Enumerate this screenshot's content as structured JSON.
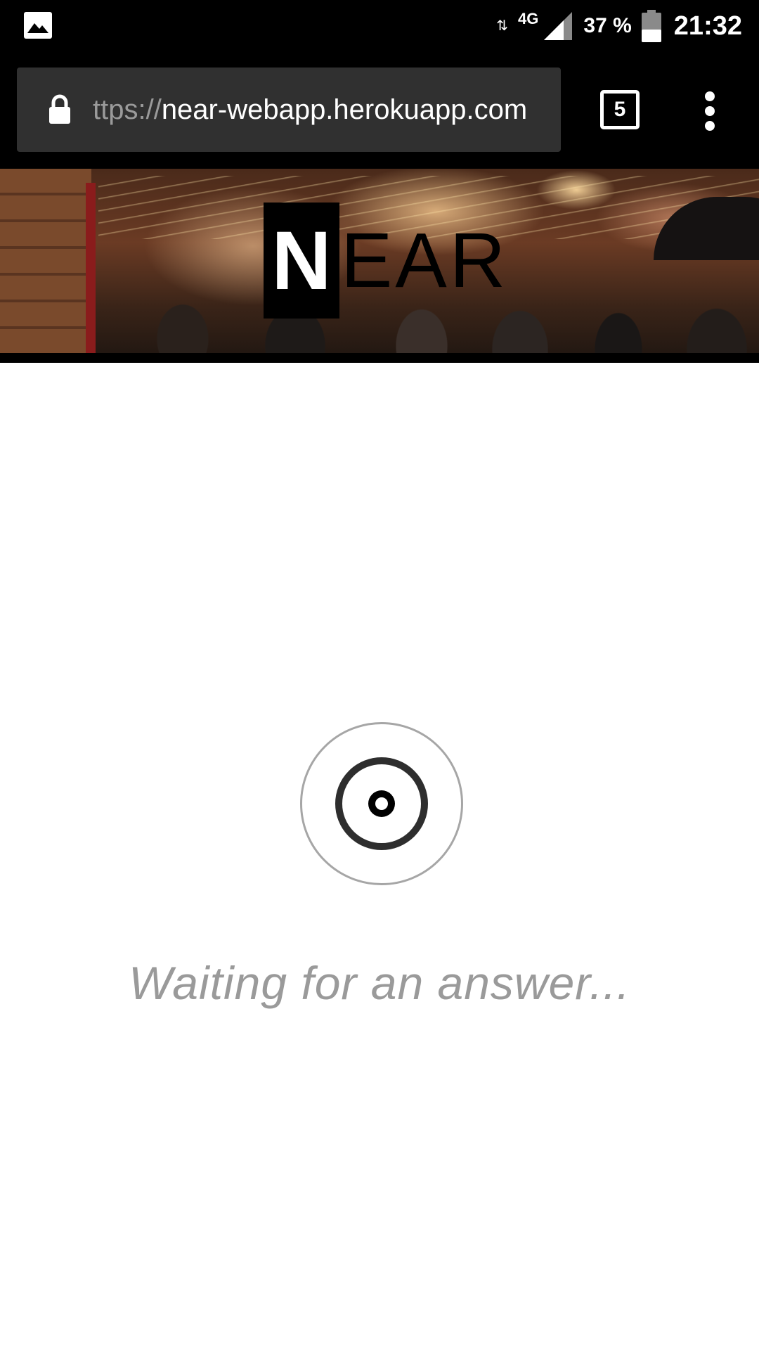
{
  "status_bar": {
    "left_icon": "image-icon",
    "network_type": "4G",
    "network_activity_icon": "updown-arrows-icon",
    "signal_icon": "signal-icon",
    "battery_percent": "37 %",
    "battery_icon": "battery-icon",
    "time": "21:32"
  },
  "browser": {
    "url_scheme": "ttps://",
    "url_host": "near-webapp.herokuapp.com",
    "lock_icon": "lock-icon",
    "tab_count": "5",
    "menu_icon": "more-vert-icon"
  },
  "banner": {
    "logo_first_letter": "N",
    "logo_rest": "EAR"
  },
  "main": {
    "indicator_icon": "radar-target-icon",
    "status_text": "Waiting for an answer..."
  },
  "colors": {
    "chrome_background": "#000000",
    "omnibox_background": "#303030",
    "waiting_text": "#9a9a9a",
    "ring_outer": "#a6a6a6",
    "ring_inner": "#2e2e2e"
  }
}
